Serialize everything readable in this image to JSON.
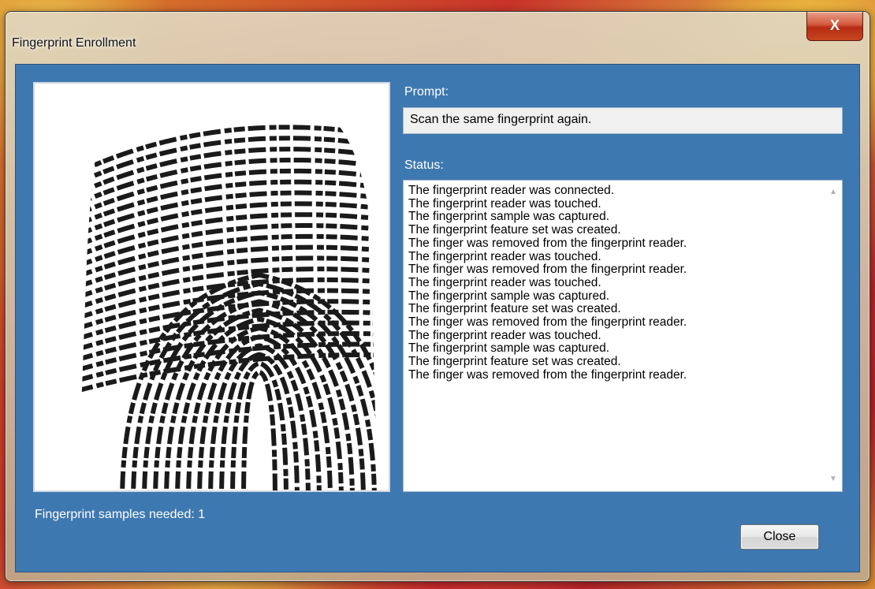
{
  "window": {
    "title": "Fingerprint Enrollment",
    "close_glyph": "X"
  },
  "prompt": {
    "label": "Prompt:",
    "value": "Scan the same fingerprint again."
  },
  "status": {
    "label": "Status:",
    "lines": [
      "The fingerprint reader was connected.",
      "The fingerprint reader was touched.",
      "The fingerprint sample was captured.",
      "The fingerprint feature set was created.",
      "The finger was removed from the fingerprint reader.",
      "The fingerprint reader was touched.",
      "The finger was removed from the fingerprint reader.",
      "The fingerprint reader was touched.",
      "The fingerprint sample was captured.",
      "The fingerprint feature set was created.",
      "The finger was removed from the fingerprint reader.",
      "The fingerprint reader was touched.",
      "The fingerprint sample was captured.",
      "The fingerprint feature set was created.",
      "The finger was removed from the fingerprint reader."
    ]
  },
  "samples_needed": "Fingerprint samples needed: 1",
  "buttons": {
    "close_label": "Close"
  },
  "icons": {
    "scroll_up": "scroll-up-arrow-icon",
    "scroll_down": "scroll-down-arrow-icon",
    "window_close": "close-icon"
  },
  "colors": {
    "client_bg": "#3e78b0",
    "close_red": "#c8451f"
  }
}
